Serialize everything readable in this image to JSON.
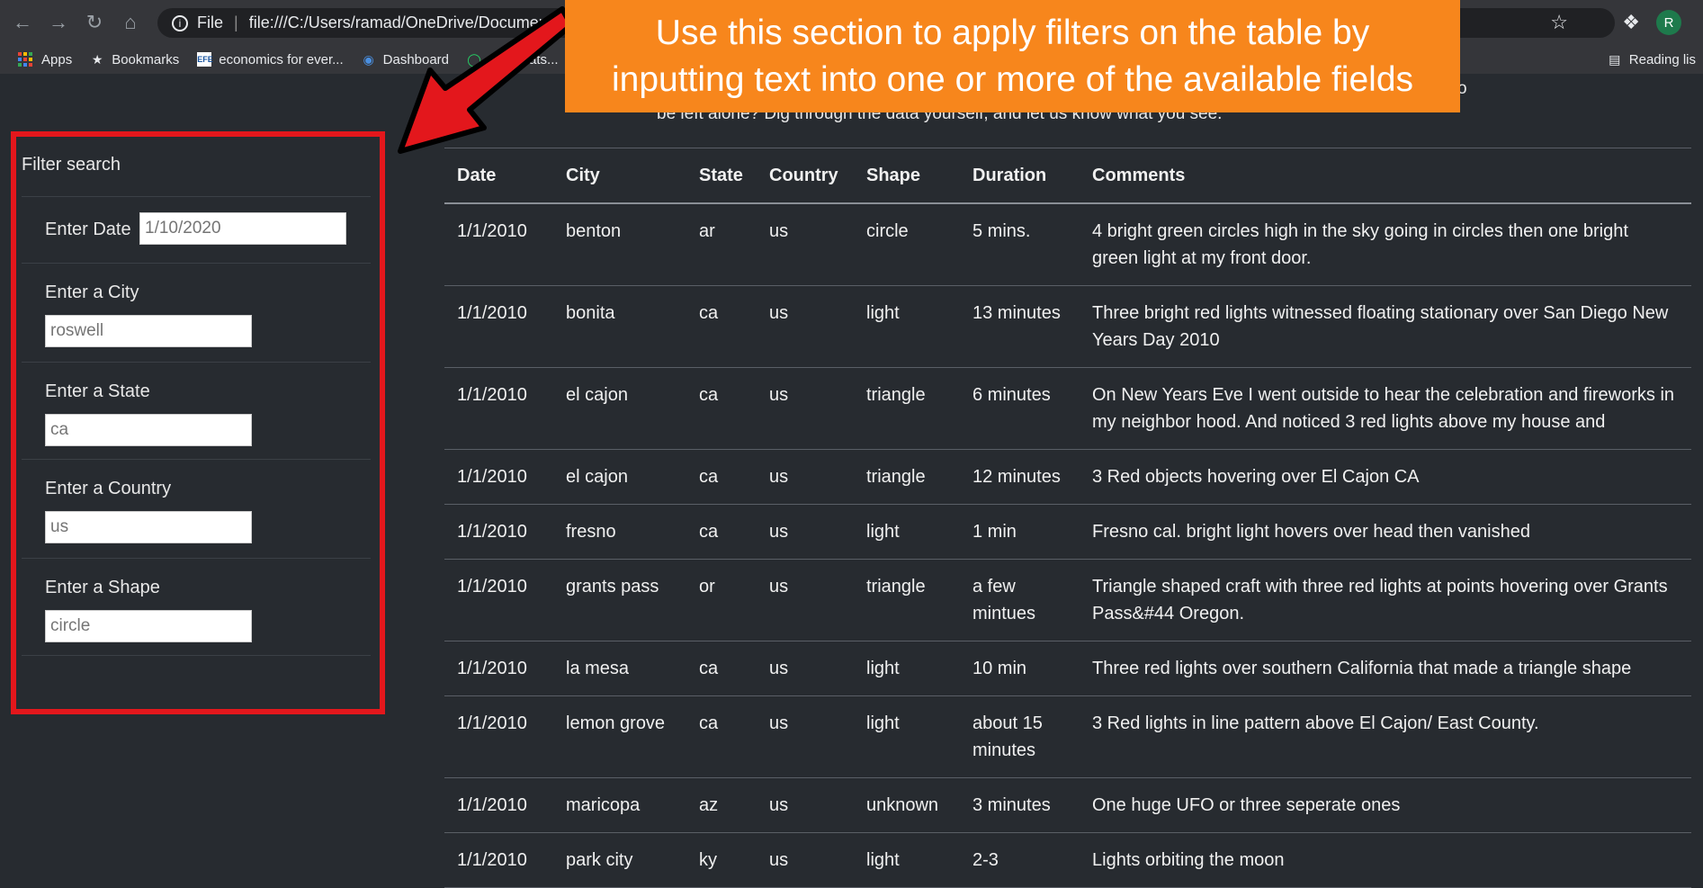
{
  "browser": {
    "scheme": "File",
    "url": "file:///C:/Users/ramad/OneDrive/Documents/Bo",
    "profile_initial": "R",
    "bookmarks": [
      {
        "label": "Apps",
        "icon": "apps-icon"
      },
      {
        "label": "Bookmarks",
        "icon": "star-icon"
      },
      {
        "label": "economics for ever...",
        "icon": "efe-icon"
      },
      {
        "label": "Dashboard",
        "icon": "dashboard-icon"
      },
      {
        "label": "(1) Whats...",
        "icon": "whatsapp-icon"
      }
    ],
    "reading_list": "Reading lis"
  },
  "callout": {
    "line1": "Use this section to apply filters on the table by",
    "line2": "inputting text into one or more of the available fields",
    "color": "#f7861c"
  },
  "intro": {
    "line2": "be left alone? Dig through the data yourself, and let us know what you see.",
    "tail": "o"
  },
  "filter": {
    "title": "Filter search",
    "date_label": "Enter Date",
    "date_placeholder": "1/10/2020",
    "city_label": "Enter a City",
    "city_placeholder": "roswell",
    "state_label": "Enter a State",
    "state_placeholder": "ca",
    "country_label": "Enter a Country",
    "country_placeholder": "us",
    "shape_label": "Enter a Shape",
    "shape_placeholder": "circle",
    "highlight_color": "#e3171c"
  },
  "table": {
    "headers": [
      "Date",
      "City",
      "State",
      "Country",
      "Shape",
      "Duration",
      "Comments"
    ],
    "rows": [
      [
        "1/1/2010",
        "benton",
        "ar",
        "us",
        "circle",
        "5 mins.",
        "4 bright green circles high in the sky going in circles then one bright green light at my front door."
      ],
      [
        "1/1/2010",
        "bonita",
        "ca",
        "us",
        "light",
        "13 minutes",
        "Three bright red lights witnessed floating stationary over San Diego New Years Day 2010"
      ],
      [
        "1/1/2010",
        "el cajon",
        "ca",
        "us",
        "triangle",
        "6 minutes",
        "On New Years Eve I went outside to hear the celebration and fireworks in my neighbor hood. And noticed 3 red lights above my house and"
      ],
      [
        "1/1/2010",
        "el cajon",
        "ca",
        "us",
        "triangle",
        "12 minutes",
        "3 Red objects hovering over El Cajon CA"
      ],
      [
        "1/1/2010",
        "fresno",
        "ca",
        "us",
        "light",
        "1 min",
        "Fresno cal. bright light hovers over head then vanished"
      ],
      [
        "1/1/2010",
        "grants pass",
        "or",
        "us",
        "triangle",
        "a few mintues",
        "Triangle shaped craft with three red lights at points hovering over Grants Pass&#44 Oregon."
      ],
      [
        "1/1/2010",
        "la mesa",
        "ca",
        "us",
        "light",
        "10 min",
        "Three red lights over southern California that made a triangle shape"
      ],
      [
        "1/1/2010",
        "lemon grove",
        "ca",
        "us",
        "light",
        "about 15 minutes",
        "3 Red lights in line pattern above El Cajon/ East County."
      ],
      [
        "1/1/2010",
        "maricopa",
        "az",
        "us",
        "unknown",
        "3 minutes",
        "One huge UFO or three seperate ones"
      ],
      [
        "1/1/2010",
        "park city",
        "ky",
        "us",
        "light",
        "2-3",
        "Lights orbiting the moon"
      ]
    ]
  }
}
